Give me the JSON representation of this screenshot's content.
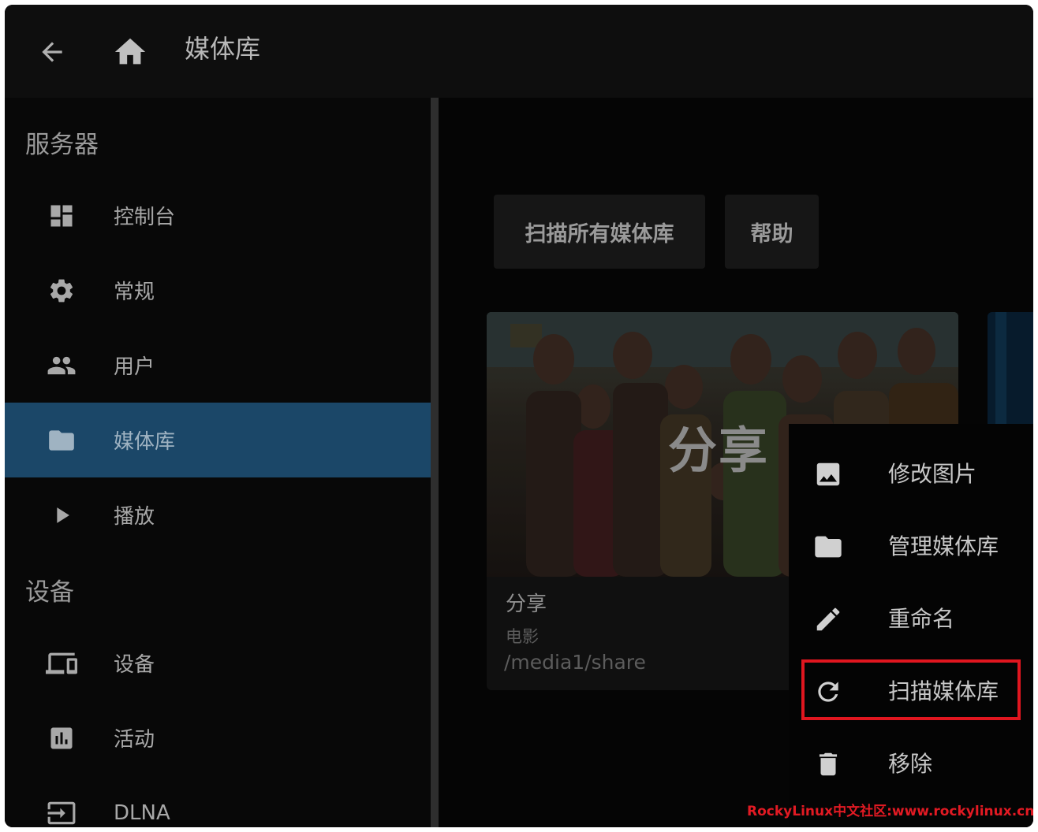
{
  "header": {
    "title": "媒体库"
  },
  "sidebar": {
    "sections": [
      {
        "title": "服务器",
        "items": [
          {
            "label": "控制台",
            "icon": "dashboard-icon"
          },
          {
            "label": "常规",
            "icon": "gear-icon"
          },
          {
            "label": "用户",
            "icon": "people-icon"
          },
          {
            "label": "媒体库",
            "icon": "folder-icon",
            "active": true
          },
          {
            "label": "播放",
            "icon": "play-icon"
          }
        ]
      },
      {
        "title": "设备",
        "items": [
          {
            "label": "设备",
            "icon": "devices-icon"
          },
          {
            "label": "活动",
            "icon": "activity-chart-icon"
          },
          {
            "label": "DLNA",
            "icon": "input-icon"
          }
        ]
      }
    ]
  },
  "main": {
    "buttons": {
      "scan_all": "扫描所有媒体库",
      "help": "帮助"
    },
    "library": {
      "poster_title": "分享",
      "name": "分享",
      "type": "电影",
      "path": "/media1/share"
    }
  },
  "context_menu": {
    "items": [
      {
        "label": "修改图片",
        "icon": "image-icon"
      },
      {
        "label": "管理媒体库",
        "icon": "folder-icon"
      },
      {
        "label": "重命名",
        "icon": "pencil-icon"
      },
      {
        "label": "扫描媒体库",
        "icon": "refresh-icon",
        "highlighted": true
      },
      {
        "label": "移除",
        "icon": "trash-icon"
      }
    ]
  },
  "colors": {
    "active_nav": "#1b4768",
    "highlight": "#e0161f"
  },
  "watermark": "RockyLinux中文社区:www.rockylinux.cn"
}
